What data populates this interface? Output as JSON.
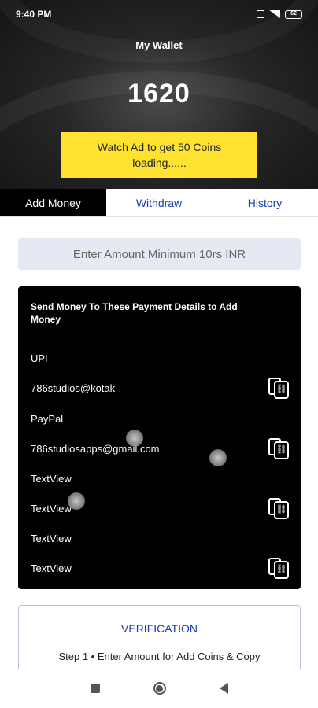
{
  "status_bar": {
    "time": "9:40 PM",
    "battery": "62"
  },
  "header": {
    "title": "My Wallet",
    "balance": "1620",
    "watch_ad_line1": "Watch Ad to get 50 Coins",
    "watch_ad_line2": "loading......"
  },
  "tabs": [
    {
      "label": "Add Money"
    },
    {
      "label": "Withdraw"
    },
    {
      "label": "History"
    }
  ],
  "amount_field": {
    "placeholder": "Enter Amount Minimum 10rs INR"
  },
  "payment": {
    "title": "Send Money To These Payment Details to Add Money",
    "rows": [
      {
        "label": "UPI"
      },
      {
        "label": "786studios@kotak"
      },
      {
        "label": "PayPal"
      },
      {
        "label": "786studiosapps@gmail.com"
      },
      {
        "label": "TextView"
      },
      {
        "label": "TextView"
      },
      {
        "label": "TextView"
      },
      {
        "label": "TextView"
      }
    ]
  },
  "verification": {
    "title": "VERIFICATION",
    "step1": "Step 1 • Enter Amount for Add Coins & Copy"
  },
  "icons": {
    "copy": "copy-link-icon",
    "nav_recents": "square-icon",
    "nav_home": "circle-icon",
    "nav_back": "triangle-back-icon"
  }
}
